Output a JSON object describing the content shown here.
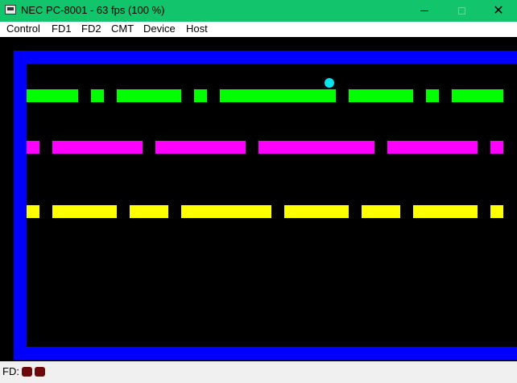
{
  "window": {
    "title": "NEC PC-8001 - 63 fps (100 %)",
    "titlebar_color": "#12c46b",
    "icon": "pc8001-app-icon",
    "controls": [
      "minimize-icon",
      "maximize-icon",
      "close-icon"
    ]
  },
  "menu": {
    "items": [
      {
        "label": "Control"
      },
      {
        "label": "FD1"
      },
      {
        "label": "FD2"
      },
      {
        "label": "CMT"
      },
      {
        "label": "Device"
      },
      {
        "label": "Host"
      }
    ]
  },
  "game": {
    "border_color": "#0000ff",
    "background_color": "#000000",
    "ball_color": "#00e5f0",
    "rows": [
      {
        "name": "green",
        "color": "#00ff00"
      },
      {
        "name": "magenta",
        "color": "#ff00ff"
      },
      {
        "name": "yellow",
        "color": "#ffff00"
      }
    ]
  },
  "status": {
    "fd_label": "FD:",
    "drive_leds": [
      {
        "drive": 1,
        "state": "off",
        "color": "#6b0a0a"
      },
      {
        "drive": 2,
        "state": "off",
        "color": "#6b0a0a"
      }
    ]
  }
}
